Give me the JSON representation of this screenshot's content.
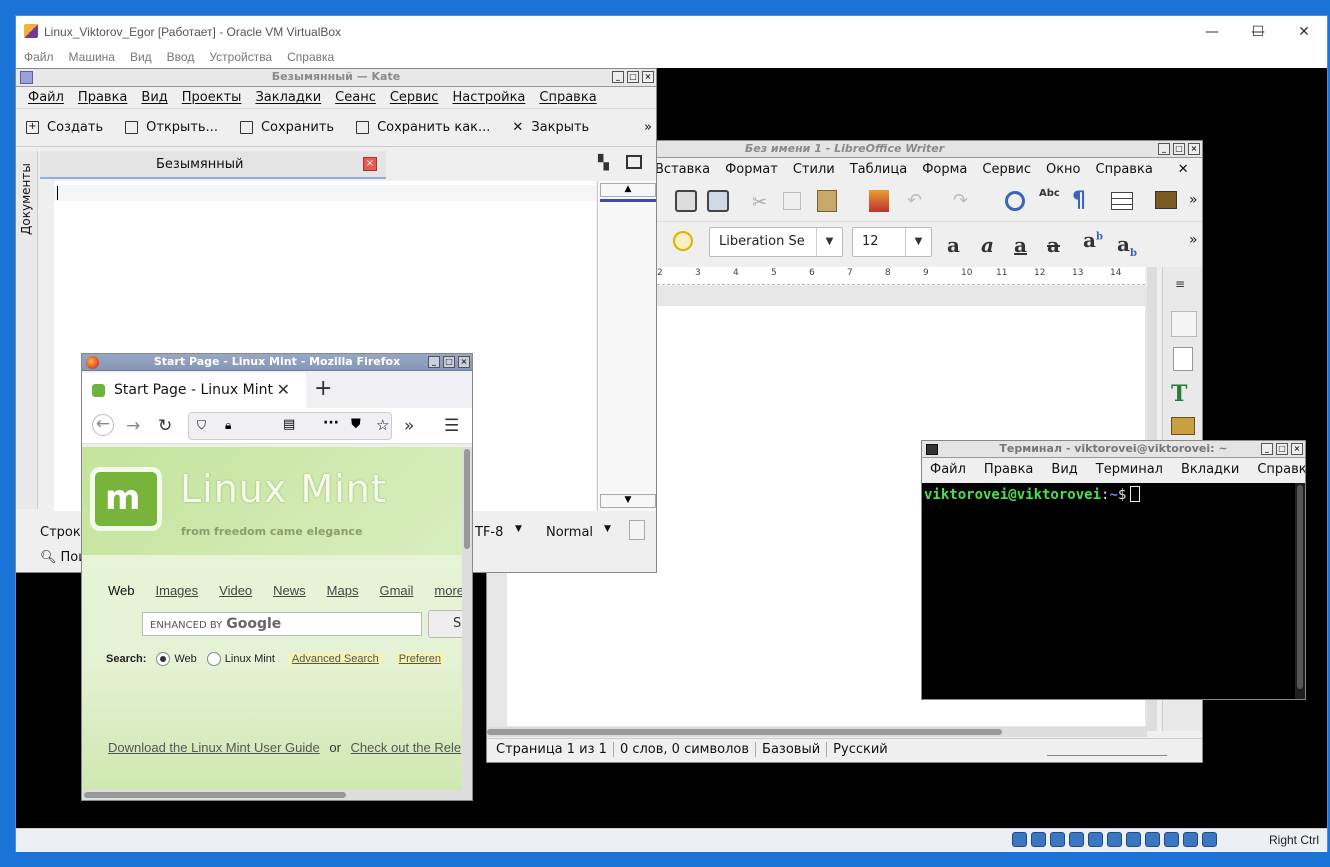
{
  "vbox": {
    "title": "Linux_Viktorov_Egor [Работает] - Oracle VM VirtualBox",
    "menu": [
      "Файл",
      "Машина",
      "Вид",
      "Ввод",
      "Устройства",
      "Справка"
    ],
    "host_key": "Right Ctrl"
  },
  "kate": {
    "title": "Безымянный  — Kate",
    "menu": [
      "Файл",
      "Правка",
      "Вид",
      "Проекты",
      "Закладки",
      "Сеанс",
      "Сервис",
      "Настройка",
      "Справка"
    ],
    "toolbar": {
      "new": "Создать",
      "open": "Открыть...",
      "save": "Сохранить",
      "save_as": "Сохранить как...",
      "close": "Закрыть",
      "more": "»"
    },
    "sidebar_label": "Документы",
    "tab_label": "Безымянный",
    "status": {
      "line": "Строка",
      "encoding": "TF-8",
      "mode": "Normal",
      "search": "Пои"
    }
  },
  "writer": {
    "title": "Без имени 1 - LibreOffice Writer",
    "menu": [
      "Вставка",
      "Формат",
      "Стили",
      "Таблица",
      "Форма",
      "Сервис",
      "Окно",
      "Справка"
    ],
    "font_name": "Liberation Se",
    "font_size": "12",
    "ruler_ticks": [
      "2",
      "3",
      "4",
      "5",
      "6",
      "7",
      "8",
      "9",
      "10",
      "11",
      "12",
      "13",
      "14"
    ],
    "status": {
      "page": "Страница 1 из 1",
      "words": "0 слов, 0 символов",
      "style": "Базовый",
      "language": "Русский"
    }
  },
  "firefox": {
    "title": "Start Page - Linux Mint - Mozilla Firefox",
    "tab_label": "Start Page - Linux Mint",
    "brand": "Linux Mint",
    "logo_letter": "m",
    "tagline": "from freedom came elegance",
    "links": [
      "Web",
      "Images",
      "Video",
      "News",
      "Maps",
      "Gmail",
      "more"
    ],
    "search_prefix": "ENHANCED BY",
    "search_brand": "Google",
    "search_button": "S",
    "search_label": "Search:",
    "radio_web": "Web",
    "radio_mint": "Linux Mint",
    "advanced_search": "Advanced Search",
    "preferences": "Preferen",
    "bottom_link1": "Download the Linux Mint User Guide",
    "bottom_or": "or",
    "bottom_link2": "Check out the Rele"
  },
  "terminal": {
    "title": "Терминал - viktorovei@viktorovei: ~",
    "menu": [
      "Файл",
      "Правка",
      "Вид",
      "Терминал",
      "Вкладки",
      "Справка"
    ],
    "prompt_user": "viktorovei@viktorovei",
    "prompt_sep": ":",
    "prompt_path": "~",
    "prompt_symbol": "$"
  }
}
